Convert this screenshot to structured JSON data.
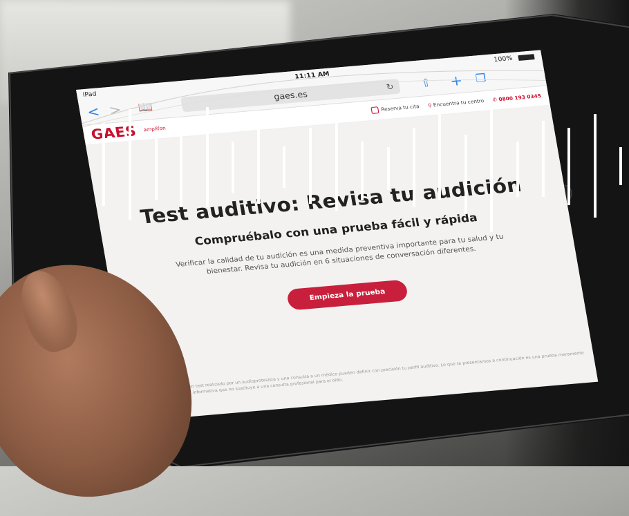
{
  "status_bar": {
    "device": "iPad",
    "time": "11:11 AM",
    "battery": "100%"
  },
  "browser": {
    "url": "gaes.es",
    "back": "<",
    "forward": ">",
    "reader_icon": "book-icon",
    "reload_icon": "reload-icon",
    "share_icon": "share-icon",
    "add_icon": "plus-icon",
    "tabs_icon": "tabs-icon"
  },
  "site_header": {
    "logo": "GAES",
    "logo_sub": "amplifon",
    "book_appointment": "Reserva tu cita",
    "find_center": "Encuentra tu centro",
    "phone": "0800 193 0345",
    "menu_icon": "hamburger-icon"
  },
  "hero": {
    "title": "Test auditivo: Revisa tu audición",
    "subtitle": "Compruébalo con una prueba fácil y rápida",
    "description": "Verificar la calidad de tu audición es una medida preventiva importante para tu salud y tu bienestar. Revisa tu audición en 6 situaciones de conversación diferentes.",
    "cta": "Empieza la prueba"
  },
  "footnote": "Te recordamos que solo un test realizado por un audioprotesista y una consulta a un médico pueden definir con precisión tu perfil auditivo. Lo que te presentamos a continuación es una prueba meramente indicativa y con finalidad informativa que no sustituye a una consulta profesional para el oído.",
  "colors": {
    "brand_red": "#c8102e",
    "cta_red": "#c8203c",
    "ios_blue": "#2f86e8",
    "overlay_bars": "#ffffff"
  }
}
